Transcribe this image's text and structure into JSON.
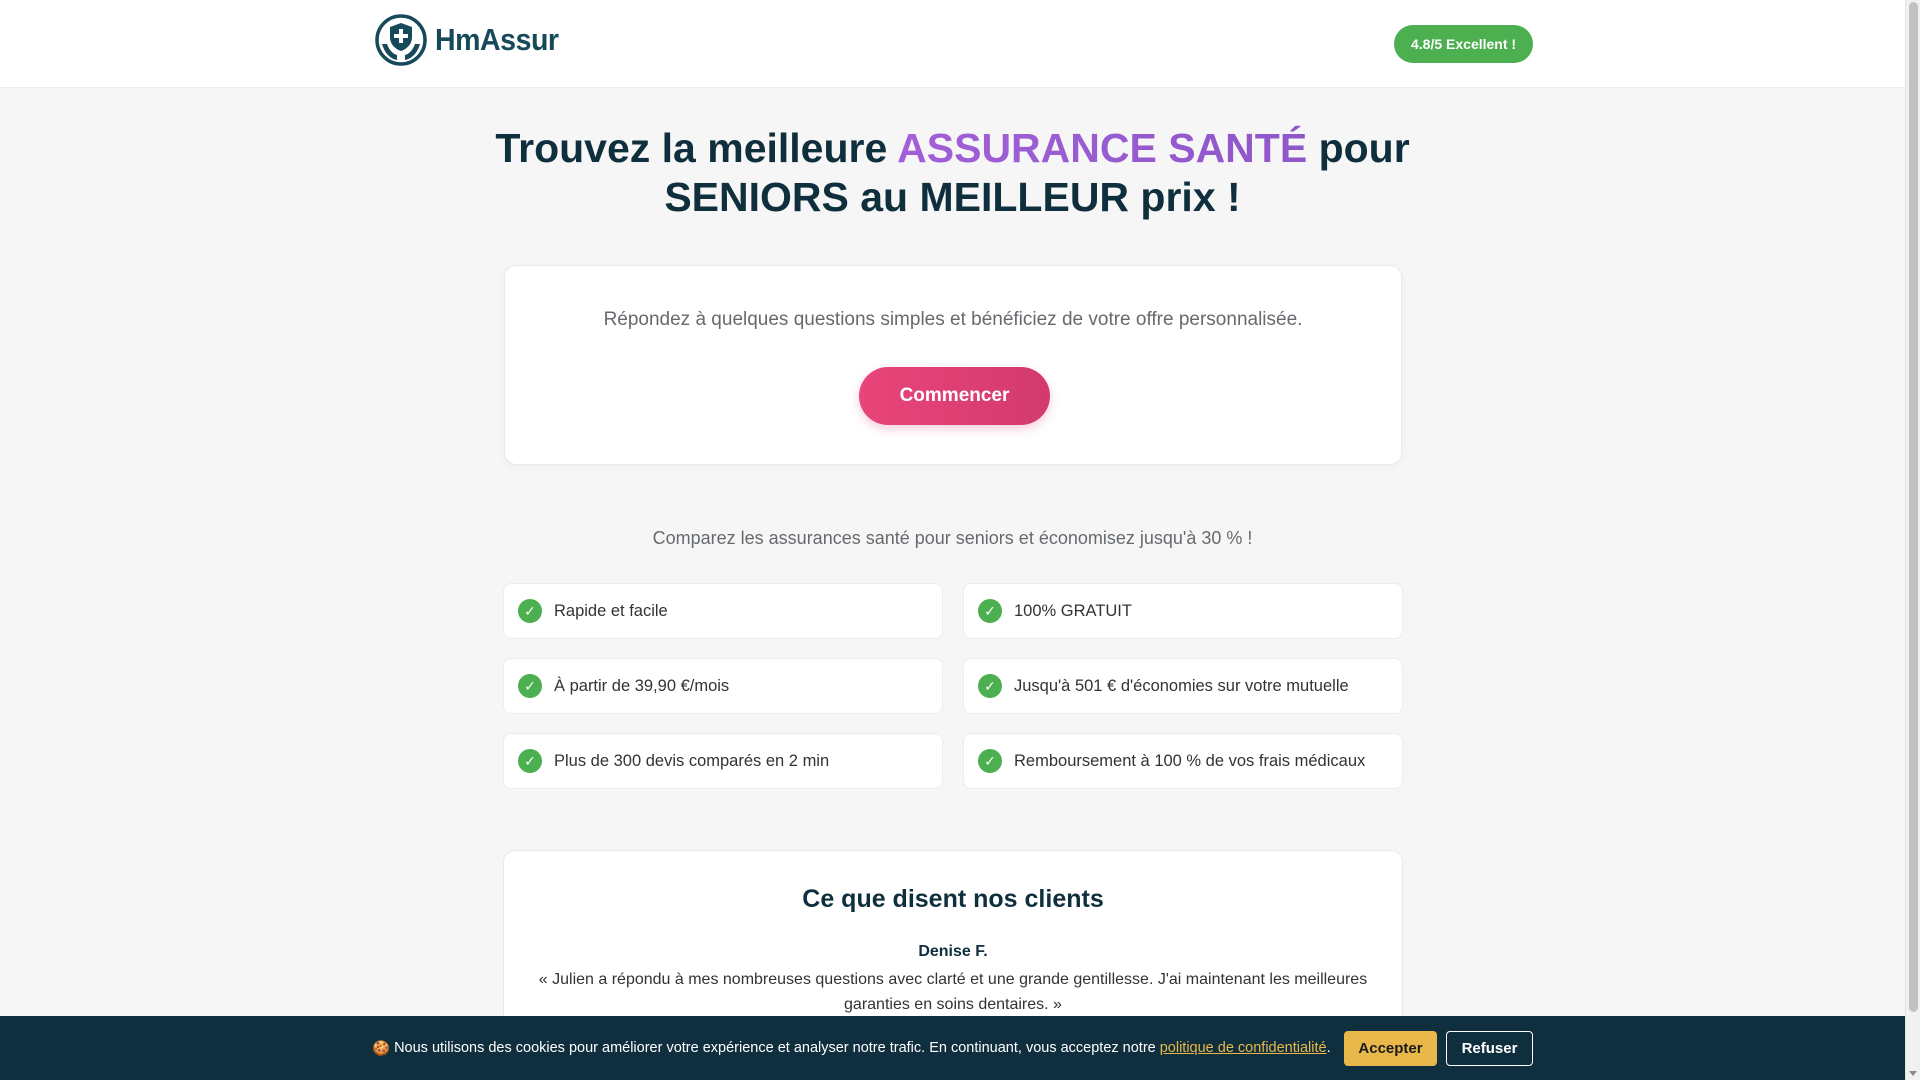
{
  "header": {
    "logo_text": "HmAssur",
    "rating_badge": "4.8/5 Excellent !"
  },
  "hero": {
    "title_part1": "Trouvez la meilleure ",
    "title_accent": "ASSURANCE SANTÉ",
    "title_part2": " pour",
    "title_line2": "SENIORS au MEILLEUR prix !"
  },
  "start_card": {
    "lead": "Répondez à quelques questions simples et bénéficiez de votre offre personnalisée.",
    "button_label": "Commencer"
  },
  "compare_text": "Comparez les assurances santé pour seniors et économisez jusqu'à 30 % !",
  "features": [
    "Rapide et facile",
    "100% GRATUIT",
    "À partir de 39,90 €/mois",
    "Jusqu'à 501 € d'économies sur votre mutuelle",
    "Plus de 300 devis comparés en 2 min",
    "Remboursement à 100 % de vos frais médicaux"
  ],
  "testimonials": {
    "title": "Ce que disent nos clients",
    "author": "Denise F.",
    "quote": "« Julien a répondu à mes nombreuses questions avec clarté et une grande gentillesse. J'ai maintenant les meilleures garanties en soins dentaires. »"
  },
  "cookie_bar": {
    "emoji": "🍪",
    "text": "Nous utilisons des cookies pour améliorer votre expérience et analyser notre trafic. En continuant, vous acceptez notre",
    "link_text": "politique de confidentialité",
    "period": ".",
    "accept_label": "Accepter",
    "refuse_label": "Refuser"
  },
  "icons": {
    "logo": "shield-cross-hands-icon",
    "check": "check-icon",
    "cookie": "cookie-icon"
  },
  "colors": {
    "brand": "#164a5b",
    "accent_purple": "#9b59d0",
    "cta_pink": "#e9457a",
    "success_green": "#4caf50",
    "cookie_bg": "#0f2e3e",
    "cookie_accent": "#e8b84a"
  }
}
